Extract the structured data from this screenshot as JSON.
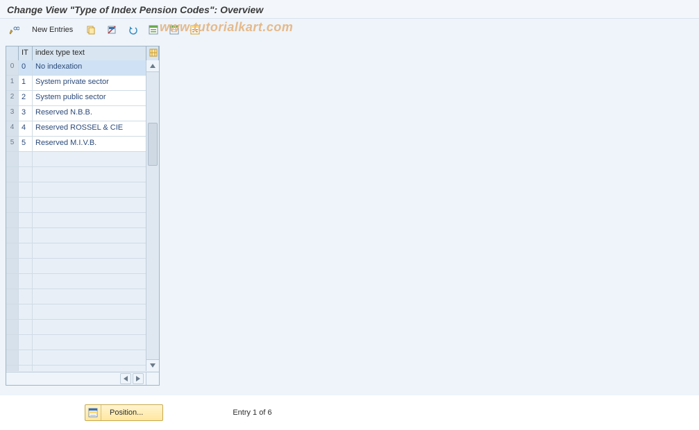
{
  "title": "Change View \"Type of Index Pension Codes\": Overview",
  "watermark": "www.tutorialkart.com",
  "toolbar": {
    "new_entries": "New Entries"
  },
  "table": {
    "headers": {
      "it": "IT",
      "text": "index type text"
    },
    "rows": [
      {
        "sel": "0",
        "it": "0",
        "text": "No indexation",
        "selected": true
      },
      {
        "sel": "1",
        "it": "1",
        "text": "System private sector"
      },
      {
        "sel": "2",
        "it": "2",
        "text": "System public sector"
      },
      {
        "sel": "3",
        "it": "3",
        "text": "Reserved N.B.B."
      },
      {
        "sel": "4",
        "it": "4",
        "text": "Reserved ROSSEL & CIE"
      },
      {
        "sel": "5",
        "it": "5",
        "text": "Reserved M.I.V.B."
      }
    ],
    "empty_row_count": 15
  },
  "footer": {
    "position_label": "Position...",
    "entry_status": "Entry 1 of 6"
  }
}
